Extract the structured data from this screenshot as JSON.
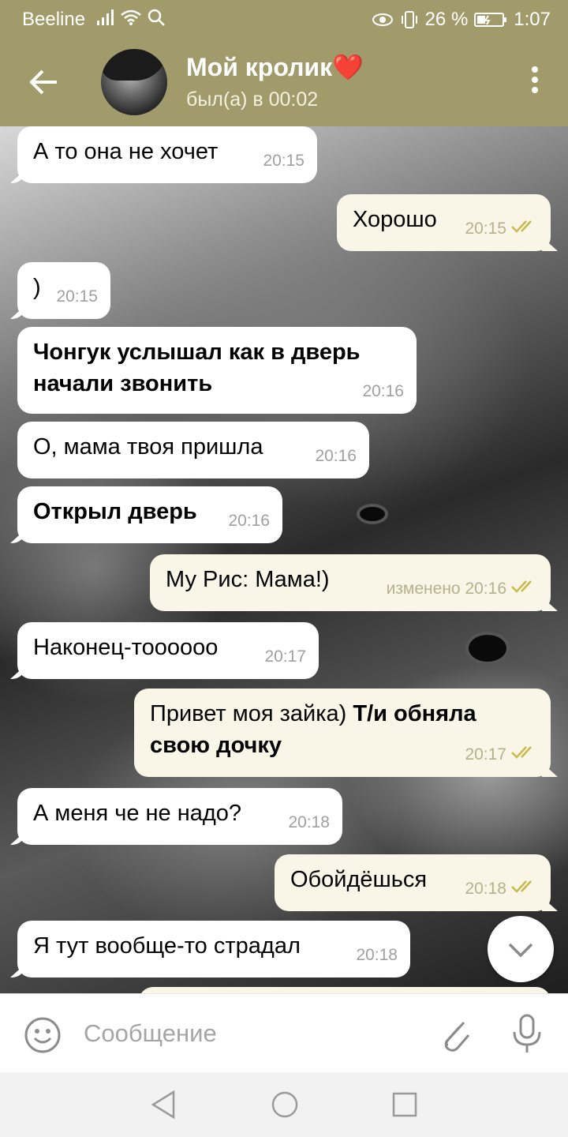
{
  "statusbar": {
    "carrier": "Beeline",
    "battery": "26 %",
    "clock": "1:07"
  },
  "header": {
    "title": "Мой кролик❤️",
    "subtitle": "был(а) в 00:02"
  },
  "messages": [
    {
      "dir": "in",
      "text": "А то она не хочет",
      "time": "20:15"
    },
    {
      "dir": "out",
      "text": "Хорошо",
      "time": "20:15"
    },
    {
      "dir": "in",
      "text": ")",
      "time": "20:15"
    },
    {
      "dir": "in",
      "text": "Чонгук услышал как в дверь начали звонить",
      "time": "20:16",
      "bold": true
    },
    {
      "dir": "in",
      "text": "О, мама твоя пришла",
      "time": "20:16"
    },
    {
      "dir": "in",
      "text": "Открыл дверь",
      "time": "20:16",
      "bold": true
    },
    {
      "dir": "out",
      "text": "Му Рис: Мама!)",
      "time": "изменено 20:16"
    },
    {
      "dir": "in",
      "text": "Наконец-тоооооо",
      "time": "20:17"
    },
    {
      "dir": "out",
      "text_plain": "Привет моя зайка) ",
      "text_bold": "Т/и обняла свою дочку",
      "time": "20:17"
    },
    {
      "dir": "in",
      "text": "А меня че не надо?",
      "time": "20:18"
    },
    {
      "dir": "out",
      "text": "Обойдёшься",
      "time": "20:18"
    },
    {
      "dir": "in",
      "text": "Я тут вообще-то страдал",
      "time": "20:18"
    }
  ],
  "input": {
    "placeholder": "Сообщение"
  },
  "colors": {
    "header": "#a19b6c",
    "incoming_bubble": "#ffffff",
    "outgoing_bubble": "#f9f6e8",
    "read_check": "#c9b84a"
  },
  "icons": [
    "back-arrow-icon",
    "more-vert-icon",
    "emoji-icon",
    "attach-icon",
    "mic-icon",
    "chevron-down-icon",
    "double-check-icon"
  ]
}
